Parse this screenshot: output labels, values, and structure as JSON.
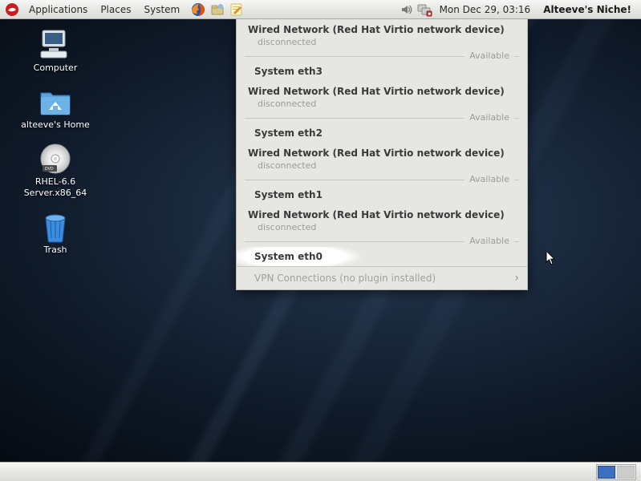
{
  "top_panel": {
    "menus": [
      "Applications",
      "Places",
      "System"
    ],
    "clock": "Mon Dec 29, 03:16",
    "right_label": "Alteeve's Niche!"
  },
  "desktop_icons": [
    {
      "id": "computer",
      "label": "Computer"
    },
    {
      "id": "home",
      "label": "alteeve's Home"
    },
    {
      "id": "dvd",
      "label": "RHEL-6.6 Server.x86_64"
    },
    {
      "id": "trash",
      "label": "Trash"
    }
  ],
  "nm_menu": {
    "device_label": "Wired Network (Red Hat Virtio network device)",
    "disconnected_label": "disconnected",
    "available_label": "Available",
    "interfaces": [
      "System eth3",
      "System eth2",
      "System eth1",
      "System eth0"
    ],
    "vpn_label": "VPN Connections (no plugin installed)"
  },
  "workspaces": {
    "count": 2,
    "active": 0
  }
}
